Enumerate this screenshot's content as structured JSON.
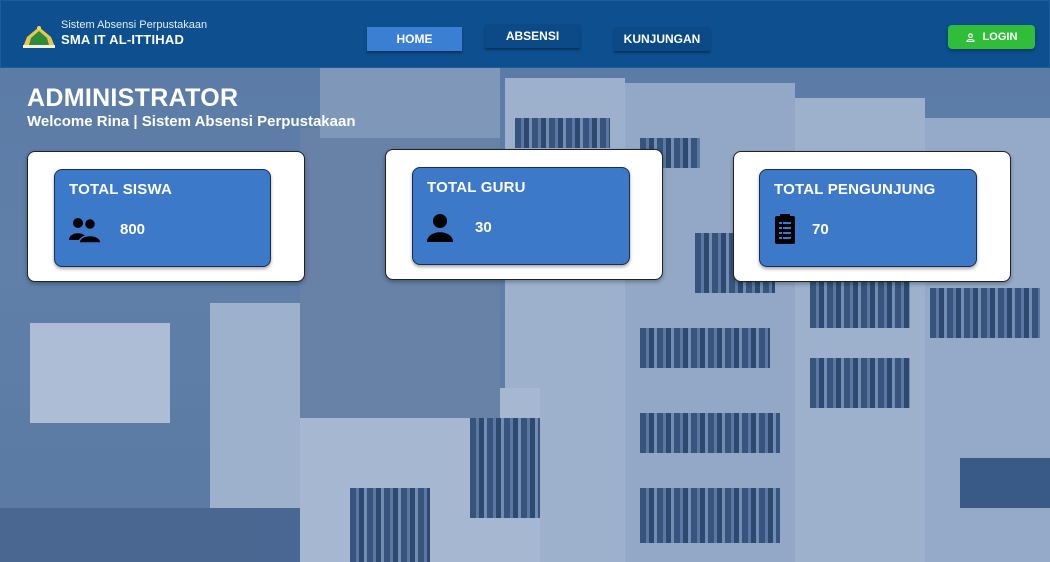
{
  "header": {
    "subtitle": "Sistem Absensi Perpustakaan",
    "title": "SMA IT AL-ITTIHAD",
    "nav": {
      "home": "HOME",
      "absensi": "ABSENSI",
      "kunjungan": "KUNJUNGAN"
    },
    "login_label": "LOGIN"
  },
  "page": {
    "title": "ADMINISTRATOR",
    "welcome": "Welcome Rina | Sistem Absensi Perpustakaan"
  },
  "stats": [
    {
      "label": "TOTAL SISWA",
      "value": "800",
      "icon": "users-group-icon"
    },
    {
      "label": "TOTAL GURU",
      "value": "30",
      "icon": "user-icon"
    },
    {
      "label": "TOTAL PENGUNJUNG",
      "value": "70",
      "icon": "clipboard-list-icon"
    }
  ],
  "colors": {
    "header_bg": "#0d4f8f",
    "nav_active": "#3b7fd4",
    "login_green": "#2fbd3a",
    "card_blue": "#3d79c9"
  }
}
